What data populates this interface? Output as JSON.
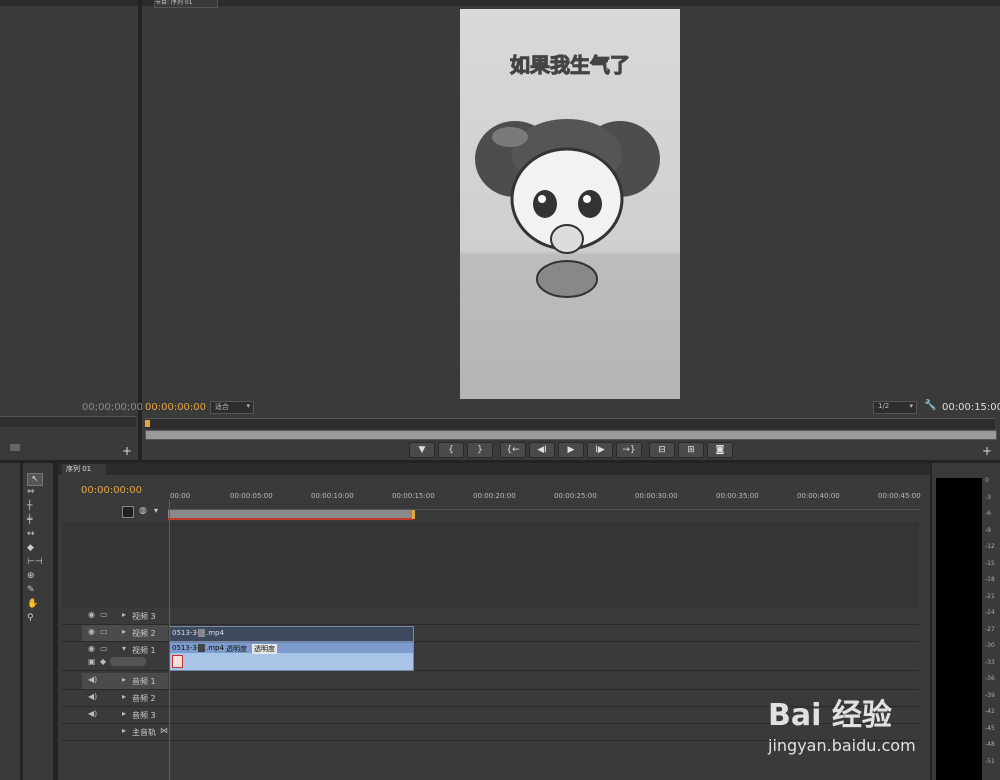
{
  "source_panel": {
    "timecode": "00;00;00;00"
  },
  "program_monitor": {
    "tab_label": "节目: 序列 01",
    "caption": "如果我生气了",
    "timecode_current": "00:00:00:00",
    "zoom_select": "适合",
    "resolution_select": "1/2",
    "timecode_duration": "00:00:15:00",
    "playhead_fraction": 0.0
  },
  "transport": {
    "marker": "▼",
    "in_point": "{",
    "out_point": "}",
    "go_to_in": "{←",
    "step_back": "◀I",
    "play": "▶",
    "step_forward": "I▶",
    "go_to_out": "→}",
    "lift": "⊟",
    "extract": "⊞",
    "export_frame": "◙",
    "add": "+"
  },
  "timeline": {
    "tab_label": "序列 01",
    "timecode": "00:00:00:00",
    "ruler_ticks": [
      "00:00",
      "00:00:05:00",
      "00:00:10:00",
      "00:00:15:00",
      "00:00:20:00",
      "00:00:25:00",
      "00:00:30:00",
      "00:00:35:00",
      "00:00:40:00",
      "00:00:45:00"
    ],
    "tracks": {
      "video3": "视频 3",
      "video2": "视频 2",
      "video1": "视频 1",
      "audio1": "音频 1",
      "audio2": "音频 2",
      "audio3": "音频 3",
      "master": "主音轨"
    },
    "clips": {
      "v2_name": "0513-3-",
      "v2_ext": ".mp4",
      "v1_name": "0513-3-",
      "v1_ext": ".mp4",
      "v1_opacity": "透明度",
      "v1_opacity2": "透明度"
    }
  },
  "audio_meter": {
    "labels": [
      "0",
      "-3",
      "-6",
      "-9",
      "-12",
      "-15",
      "-18",
      "-21",
      "-24",
      "-27",
      "-30",
      "-33",
      "-36",
      "-39",
      "-42",
      "-45",
      "-48",
      "-51"
    ]
  },
  "watermark": {
    "line1": "Bai 经验",
    "line2": "jingyan.baidu.com"
  }
}
